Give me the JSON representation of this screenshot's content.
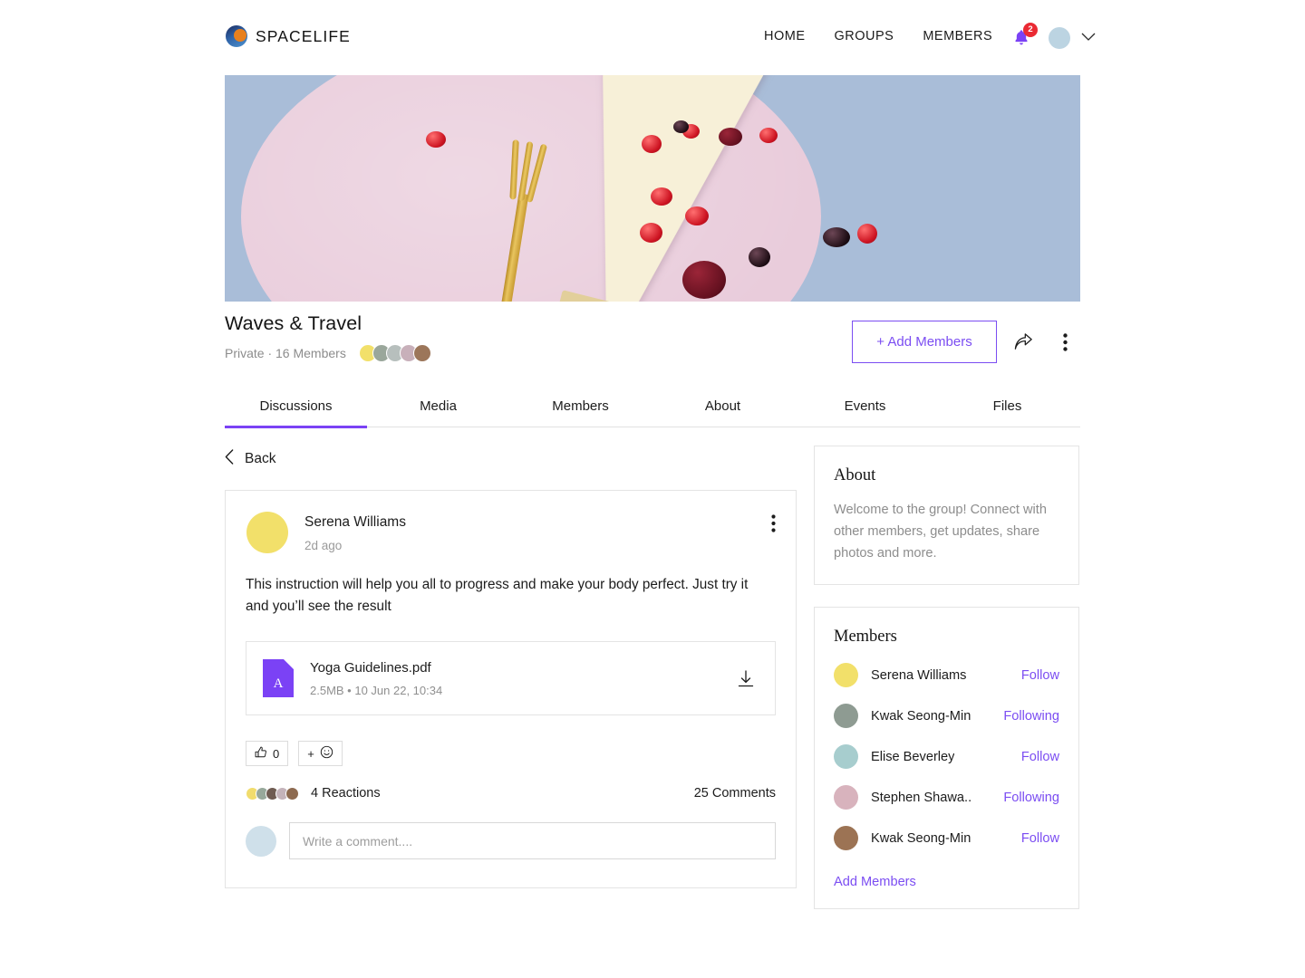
{
  "brand": {
    "name": "SPACELIFE",
    "logo_icon": "spacelife-logo-icon"
  },
  "nav": {
    "links": [
      {
        "label": "HOME"
      },
      {
        "label": "GROUPS"
      },
      {
        "label": "MEMBERS"
      }
    ],
    "notifications": {
      "icon": "bell-icon",
      "count": "2",
      "badge_color": "#ea2a33",
      "icon_color": "#7b42f5"
    },
    "avatar_icon": "user-avatar",
    "chevron_icon": "chevron-down-icon"
  },
  "hero": {
    "image_alt": "cheesecake-slice-with-berries-on-pink-plate",
    "bg_color": "#a9bdd8",
    "plate_color": "#e9ccdb"
  },
  "group": {
    "title": "Waves & Travel",
    "privacy": "Private",
    "separator": "·",
    "members_count": "16 Members",
    "meta_line": "Private · 16 Members",
    "add_members_label": "+ Add Members",
    "share_icon": "share-icon",
    "more_icon": "more-vertical-icon",
    "accent_color": "#7b4df2",
    "member_avatars": [
      {
        "name": "member-avatar-1",
        "bg": "#f2e06a",
        "hair": "#221a14",
        "body": "#e9a23b"
      },
      {
        "name": "member-avatar-2",
        "bg": "#9aa79b",
        "hair": "#1c1410",
        "body": "#b9cbb6"
      },
      {
        "name": "member-avatar-3",
        "bg": "#b7bfbd",
        "hair": "#241a18",
        "body": "#cfd6d3"
      },
      {
        "name": "member-avatar-4",
        "bg": "#c8b0ba",
        "hair": "#2a1d18",
        "body": "#8e8e92"
      },
      {
        "name": "member-avatar-5",
        "bg": "#9c765a",
        "hair": "#241812",
        "body": "#c59a79"
      }
    ]
  },
  "tabs": [
    {
      "label": "Discussions",
      "active": true
    },
    {
      "label": "Media",
      "active": false
    },
    {
      "label": "Members",
      "active": false
    },
    {
      "label": "About",
      "active": false
    },
    {
      "label": "Events",
      "active": false
    },
    {
      "label": "Files",
      "active": false
    }
  ],
  "back": {
    "label": "Back",
    "icon": "chevron-left-icon"
  },
  "post": {
    "author": "Serena Williams",
    "time": "2d ago",
    "menu_icon": "more-vertical-icon",
    "body": "This instruction will help you all to progress and make your body perfect. Just try it and you’ll see the result",
    "attachment": {
      "name": "Yoga Guidelines.pdf",
      "meta": "2.5MB • 10 Jun 22, 10:34",
      "size": "2.5MB",
      "date": "10 Jun 22, 10:34",
      "file_icon": "pdf-file-icon",
      "download_icon": "download-icon",
      "icon_color": "#7b42f5"
    },
    "like": {
      "icon": "thumbs-up-icon",
      "count": "0"
    },
    "add_reaction": {
      "label": "+",
      "icon": "smiley-icon"
    },
    "reactions_label": "4 Reactions",
    "comments_label": "25 Comments",
    "reaction_avatars": [
      {
        "name": "reaction-avatar-1",
        "bg": "#f1dc6d",
        "hair": "#221a14",
        "body": "#e9a23b"
      },
      {
        "name": "reaction-avatar-2",
        "bg": "#97a89b",
        "hair": "#1c1410",
        "body": "#b9cbb6"
      },
      {
        "name": "reaction-avatar-3",
        "bg": "#6f5b52",
        "hair": "#241a18",
        "body": "#3c3230"
      },
      {
        "name": "reaction-avatar-4",
        "bg": "#c4b3ba",
        "hair": "#2a1d18",
        "body": "#8e8e92"
      },
      {
        "name": "reaction-avatar-5",
        "bg": "#8d6a50",
        "hair": "#241812",
        "body": "#c59a79"
      }
    ],
    "comment_box": {
      "placeholder": "Write a comment....",
      "value": "",
      "avatar_icon": "current-user-avatar"
    }
  },
  "sidebar": {
    "about": {
      "title": "About",
      "text": "Welcome to the group! Connect with other members, get updates, share photos and more."
    },
    "members": {
      "title": "Members",
      "add_link": "Add Members",
      "list": [
        {
          "name": "Serena Williams",
          "action": "Follow",
          "bg": "#f2e06a",
          "hair": "#221a14",
          "body": "#e9a23b"
        },
        {
          "name": "Kwak Seong-Min",
          "action": "Following",
          "bg": "#8e9b92",
          "hair": "#17100d",
          "body": "#a9c0ab"
        },
        {
          "name": "Elise Beverley",
          "action": "Follow",
          "bg": "#a7cdce",
          "hair": "#231a19",
          "body": "#dfe5e3"
        },
        {
          "name": "Stephen Shawa..",
          "action": "Following",
          "bg": "#d8b3bd",
          "hair": "#2e2019",
          "body": "#7d7d83"
        },
        {
          "name": "Kwak Seong-Min",
          "action": "Follow",
          "bg": "#9c7354",
          "hair": "#231711",
          "body": "#c08f6c"
        }
      ]
    }
  }
}
